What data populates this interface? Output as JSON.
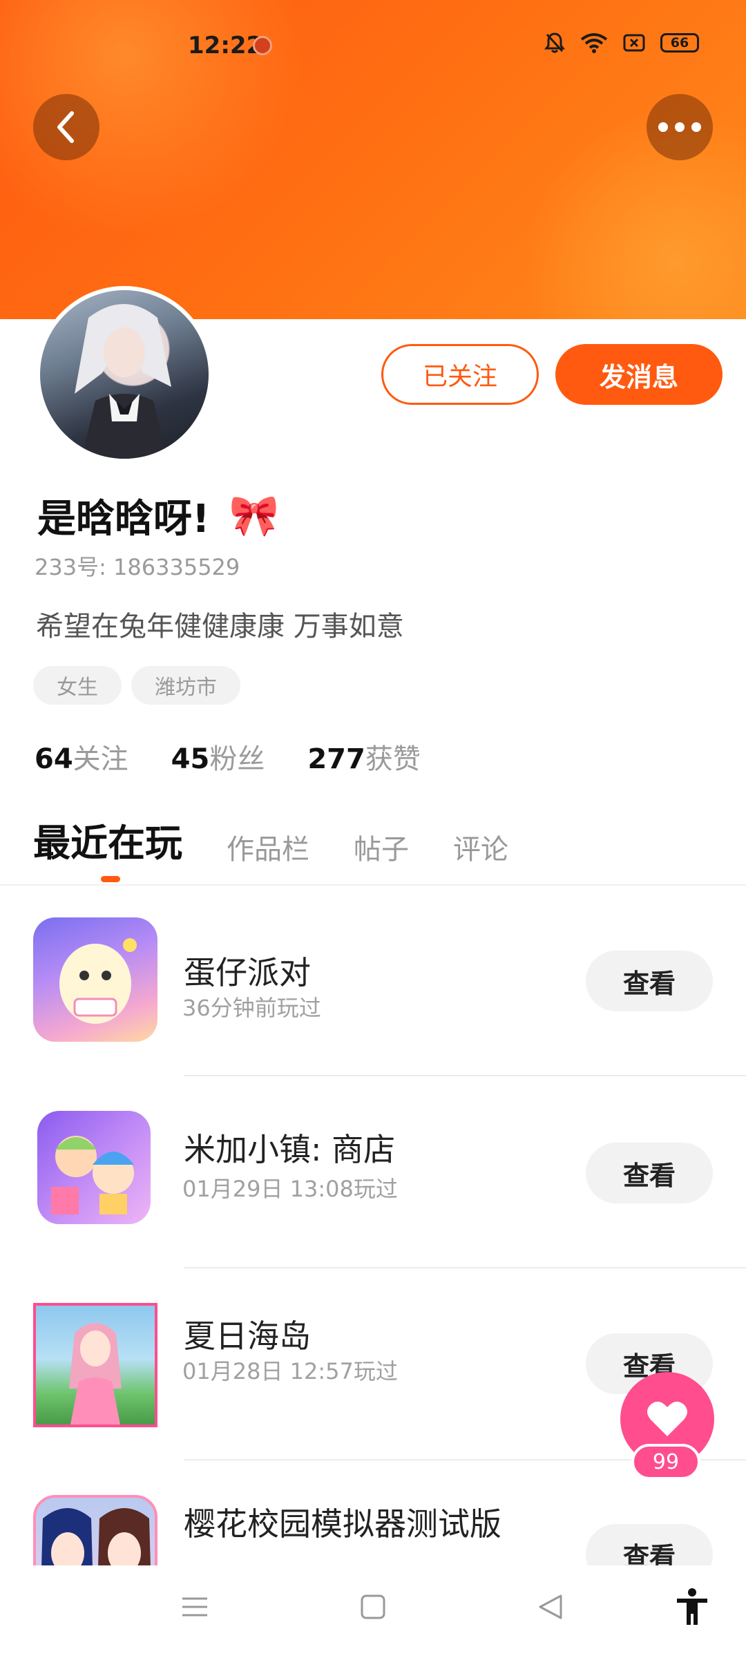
{
  "status_bar": {
    "time": "12:22",
    "battery": "66"
  },
  "colors": {
    "accent": "#ff5a10",
    "like": "#ff4d8d"
  },
  "header": {
    "back_icon": "chevron-left-icon",
    "more_icon": "more-horizontal-icon"
  },
  "profile": {
    "follow_button": "已关注",
    "message_button": "发消息",
    "name": "是晗晗呀!",
    "name_emoji": "🎀",
    "uid": "233号: 186335529",
    "bio": "希望在兔年健健康康 万事如意",
    "tags": [
      "女生",
      "潍坊市"
    ],
    "stats": [
      {
        "num": "64",
        "label": "关注"
      },
      {
        "num": "45",
        "label": "粉丝"
      },
      {
        "num": "277",
        "label": "获赞"
      }
    ]
  },
  "tabs": [
    "最近在玩",
    "作品栏",
    "帖子",
    "评论"
  ],
  "games": [
    {
      "title": "蛋仔派对",
      "time": "36分钟前玩过",
      "action": "查看"
    },
    {
      "title": "米加小镇: 商店",
      "time": "01月29日 13:08玩过",
      "action": "查看"
    },
    {
      "title": "夏日海岛",
      "time": "01月28日 12:57玩过",
      "action": "查看"
    },
    {
      "title": "樱花校园模拟器测试版",
      "time": "",
      "action": "查看"
    }
  ],
  "like_fab": {
    "count": "99",
    "icon": "heart-icon"
  },
  "nav": {
    "menu_icon": "menu-icon",
    "home_icon": "square-icon",
    "back_icon": "triangle-back-icon",
    "accessibility_icon": "accessibility-icon"
  }
}
